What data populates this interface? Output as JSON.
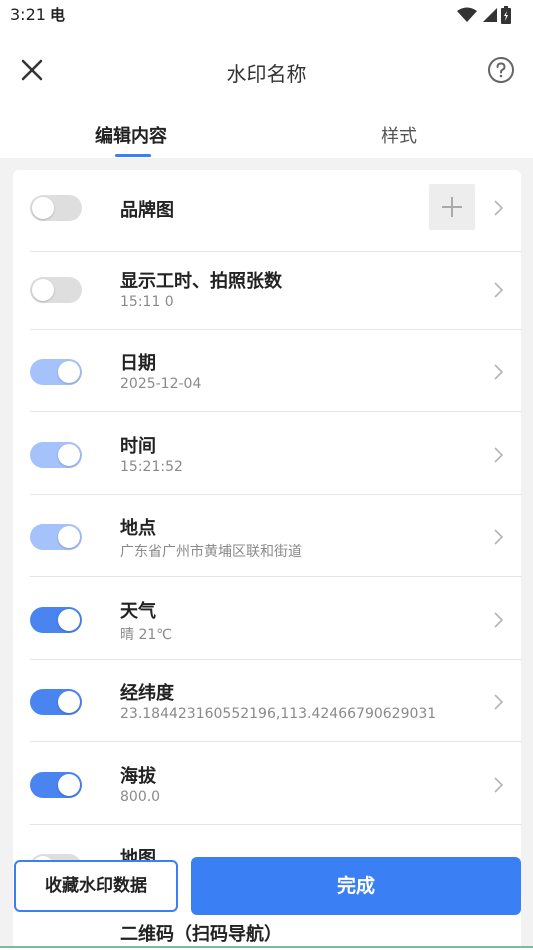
{
  "status_bar": {
    "time": "3:21",
    "extra_glyph": "电",
    "icons": [
      "wifi-icon",
      "signal-icon",
      "battery-icon"
    ]
  },
  "header": {
    "title": "水印名称",
    "close_icon": "close-icon",
    "help_icon": "help-icon"
  },
  "tabs": [
    {
      "label": "编辑内容",
      "active": true
    },
    {
      "label": "样式",
      "active": false
    }
  ],
  "items": [
    {
      "title": "品牌图",
      "subtitle": "",
      "toggle": "off",
      "has_add": true
    },
    {
      "title": "显示工时、拍照张数",
      "subtitle": "15:11  0",
      "toggle": "off"
    },
    {
      "title": "日期",
      "subtitle": "2025-12-04",
      "toggle": "on-light"
    },
    {
      "title": "时间",
      "subtitle": "15:21:52",
      "toggle": "on-light"
    },
    {
      "title": "地点",
      "subtitle": "广东省广州市黄埔区联和街道",
      "toggle": "on-light"
    },
    {
      "title": "天气",
      "subtitle": "晴 21℃",
      "toggle": "on"
    },
    {
      "title": "经纬度",
      "subtitle": "23.184423160552196,113.42466790629031",
      "toggle": "on"
    },
    {
      "title": "海拔",
      "subtitle": "800.0",
      "toggle": "on"
    },
    {
      "title": "地图",
      "subtitle": "",
      "toggle": "off"
    }
  ],
  "peek_item": "二维码（扫码导航）",
  "actions": {
    "favorite_label": "收藏水印数据",
    "done_label": "完成"
  },
  "colors": {
    "accent": "#3b7ff5",
    "toggle_on": "#4a84f1",
    "toggle_on_light": "#a5c2fb",
    "toggle_off": "#dedede"
  }
}
